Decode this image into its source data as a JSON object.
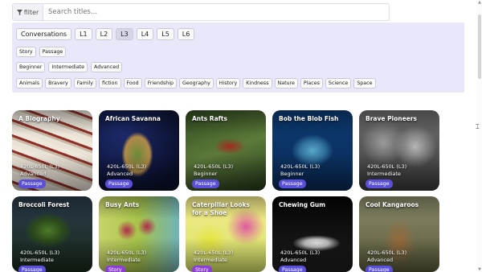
{
  "search": {
    "filter_label": "filter",
    "placeholder": "Search titles..."
  },
  "levels": [
    "Conversations",
    "L1",
    "L2",
    "L3",
    "L4",
    "L5",
    "L6"
  ],
  "active_level": "L3",
  "types": [
    "Story",
    "Passage"
  ],
  "difficulties": [
    "Beginner",
    "Intermediate",
    "Advanced"
  ],
  "topics": [
    "Animals",
    "Bravery",
    "Family",
    "fiction",
    "Food",
    "Friendship",
    "Geography",
    "History",
    "Kindness",
    "Nature",
    "Places",
    "Science",
    "Space"
  ],
  "cards": [
    {
      "title": "A Biography",
      "level": "420L-650L (L3)",
      "difficulty": "Advanced",
      "tag": "Passage"
    },
    {
      "title": "African Savanna",
      "level": "420L-650L (L3)",
      "difficulty": "Advanced",
      "tag": "Passage"
    },
    {
      "title": "Ants Rafts",
      "level": "420L-650L (L3)",
      "difficulty": "Beginner",
      "tag": "Passage"
    },
    {
      "title": "Bob the Blob Fish",
      "level": "420L-650L (L3)",
      "difficulty": "Beginner",
      "tag": "Passage"
    },
    {
      "title": "Brave Pioneers",
      "level": "420L-650L (L3)",
      "difficulty": "Intermediate",
      "tag": "Passage"
    },
    {
      "title": "Broccoli Forest",
      "level": "420L-650L (L3)",
      "difficulty": "Intermediate",
      "tag": "Passage"
    },
    {
      "title": "Busy Ants",
      "level": "420L-650L (L3)",
      "difficulty": "Intermediate",
      "tag": "Story"
    },
    {
      "title": "Caterpillar Looks for a Shoe",
      "level": "420L-650L (L3)",
      "difficulty": "Intermediate",
      "tag": "Story"
    },
    {
      "title": "Chewing Gum",
      "level": "420L-650L (L3)",
      "difficulty": "Advanced",
      "tag": "Passage"
    },
    {
      "title": "Cool Kangaroos",
      "level": "420L-650L (L3)",
      "difficulty": "Advanced",
      "tag": "Passage"
    }
  ],
  "colors": {
    "panel_bg": "#e8e8fa",
    "passage_tag": "#5a4fd6",
    "story_tag": "#8c3fd8"
  }
}
